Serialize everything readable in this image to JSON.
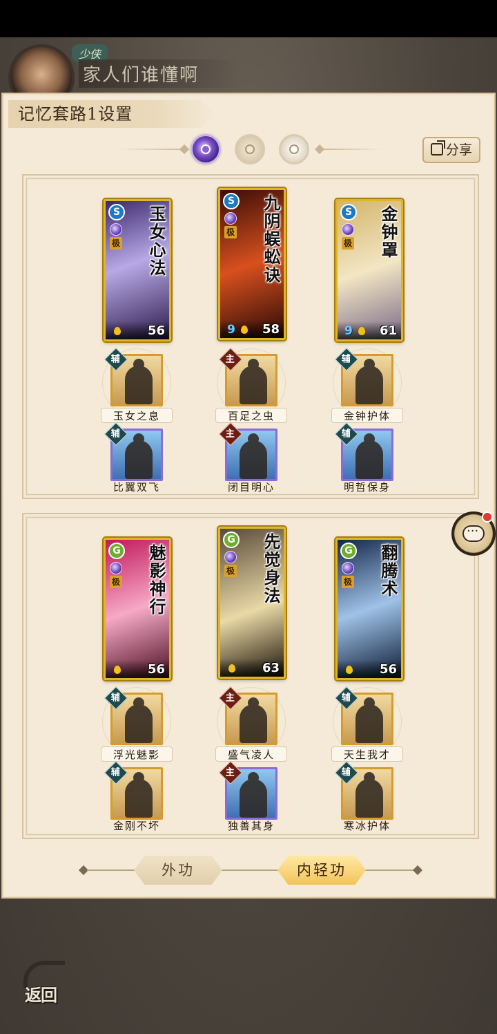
{
  "player": {
    "rank": "少侠",
    "name": "家人们谁懂啊"
  },
  "modal": {
    "title": "记忆套路1设置",
    "share_label": "分享"
  },
  "panels": [
    {
      "cards": [
        {
          "name": "玉女心法",
          "level": "56",
          "element": "S",
          "elem_color": "blue",
          "tier": "极",
          "extra": "",
          "art": [
            "#3d2a6e",
            "#b8a9e6",
            "#2a1a4a"
          ]
        },
        {
          "name": "九阴蜈蚣诀",
          "level": "58",
          "element": "S",
          "elem_color": "blue",
          "tier": "极",
          "extra": "9",
          "art": [
            "#3a0d08",
            "#d8501e",
            "#2a0a06"
          ]
        },
        {
          "name": "金钟罩",
          "level": "61",
          "element": "S",
          "elem_color": "blue",
          "tier": "极",
          "extra": "9",
          "art": [
            "#d4b56b",
            "#f2e6c4",
            "#7a6a88"
          ]
        }
      ],
      "skills_row1": [
        {
          "tag": "辅",
          "name": "玉女之息"
        },
        {
          "tag": "主",
          "name": "百足之虫"
        },
        {
          "tag": "辅",
          "name": "金钟护体"
        }
      ],
      "skills_row2": [
        {
          "tag": "辅",
          "name": "比翼双飞"
        },
        {
          "tag": "主",
          "name": "闭目明心"
        },
        {
          "tag": "辅",
          "name": "明哲保身"
        }
      ]
    },
    {
      "cards": [
        {
          "name": "魅影神行",
          "level": "56",
          "element": "G",
          "elem_color": "green",
          "tier": "极",
          "extra": "",
          "art": [
            "#c2185b",
            "#f6a9c5",
            "#4a0f22"
          ]
        },
        {
          "name": "先觉身法",
          "level": "63",
          "element": "G",
          "elem_color": "green",
          "tier": "极",
          "extra": "",
          "art": [
            "#5a4a3a",
            "#e9d9a6",
            "#1a1208"
          ]
        },
        {
          "name": "翻腾术",
          "level": "56",
          "element": "G",
          "elem_color": "green",
          "tier": "极",
          "extra": "",
          "art": [
            "#14274a",
            "#9fc2e6",
            "#0b1a33"
          ]
        }
      ],
      "skills_row1": [
        {
          "tag": "辅",
          "name": "浮光魅影"
        },
        {
          "tag": "主",
          "name": "盛气凌人"
        },
        {
          "tag": "辅",
          "name": "天生我才"
        }
      ],
      "skills_row2": [
        {
          "tag": "辅",
          "name": "金刚不坏"
        },
        {
          "tag": "主",
          "name": "独善其身"
        },
        {
          "tag": "辅",
          "name": "寒冰护体"
        }
      ]
    }
  ],
  "tabs": {
    "outer": "外功",
    "inner": "内轻功"
  },
  "back_label": "返回",
  "colors": {
    "card_border": "#e0b626",
    "panel_bg": "#f4ead7",
    "tag_fu": "#1e4a4f",
    "tag_zhu": "#6b1f14"
  }
}
